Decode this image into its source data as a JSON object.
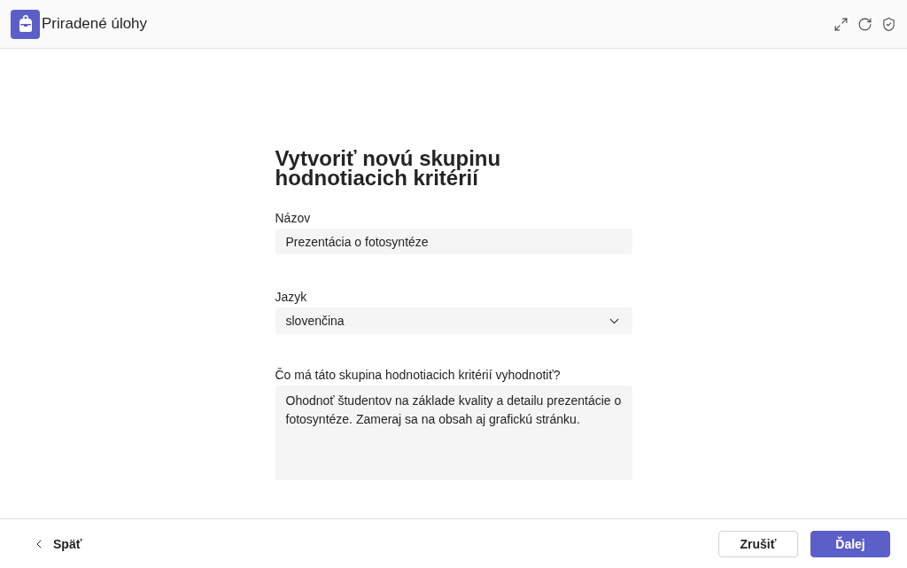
{
  "header": {
    "title": "Priradené úlohy"
  },
  "form": {
    "title": "Vytvoriť novú skupinu hodnotiacich kritérií",
    "fields": [
      {
        "kind": "text",
        "label": "Názov",
        "value": "Prezentácia o fotosyntéze"
      },
      {
        "kind": "select",
        "label": "Jazyk",
        "value": "slovenčina"
      },
      {
        "kind": "textarea",
        "label": "Čo má táto skupina hodnotiacich kritérií vyhodnotiť?",
        "value": "Ohodnoť študentov na základe kvality a detailu prezentácie o fotosyntéze. Zameraj sa na obsah aj grafickú stránku."
      }
    ]
  },
  "footer": {
    "back": "Späť",
    "buttons": [
      {
        "label": "Zrušiť",
        "kind": "secondary"
      },
      {
        "label": "Ďalej",
        "kind": "primary"
      }
    ]
  }
}
